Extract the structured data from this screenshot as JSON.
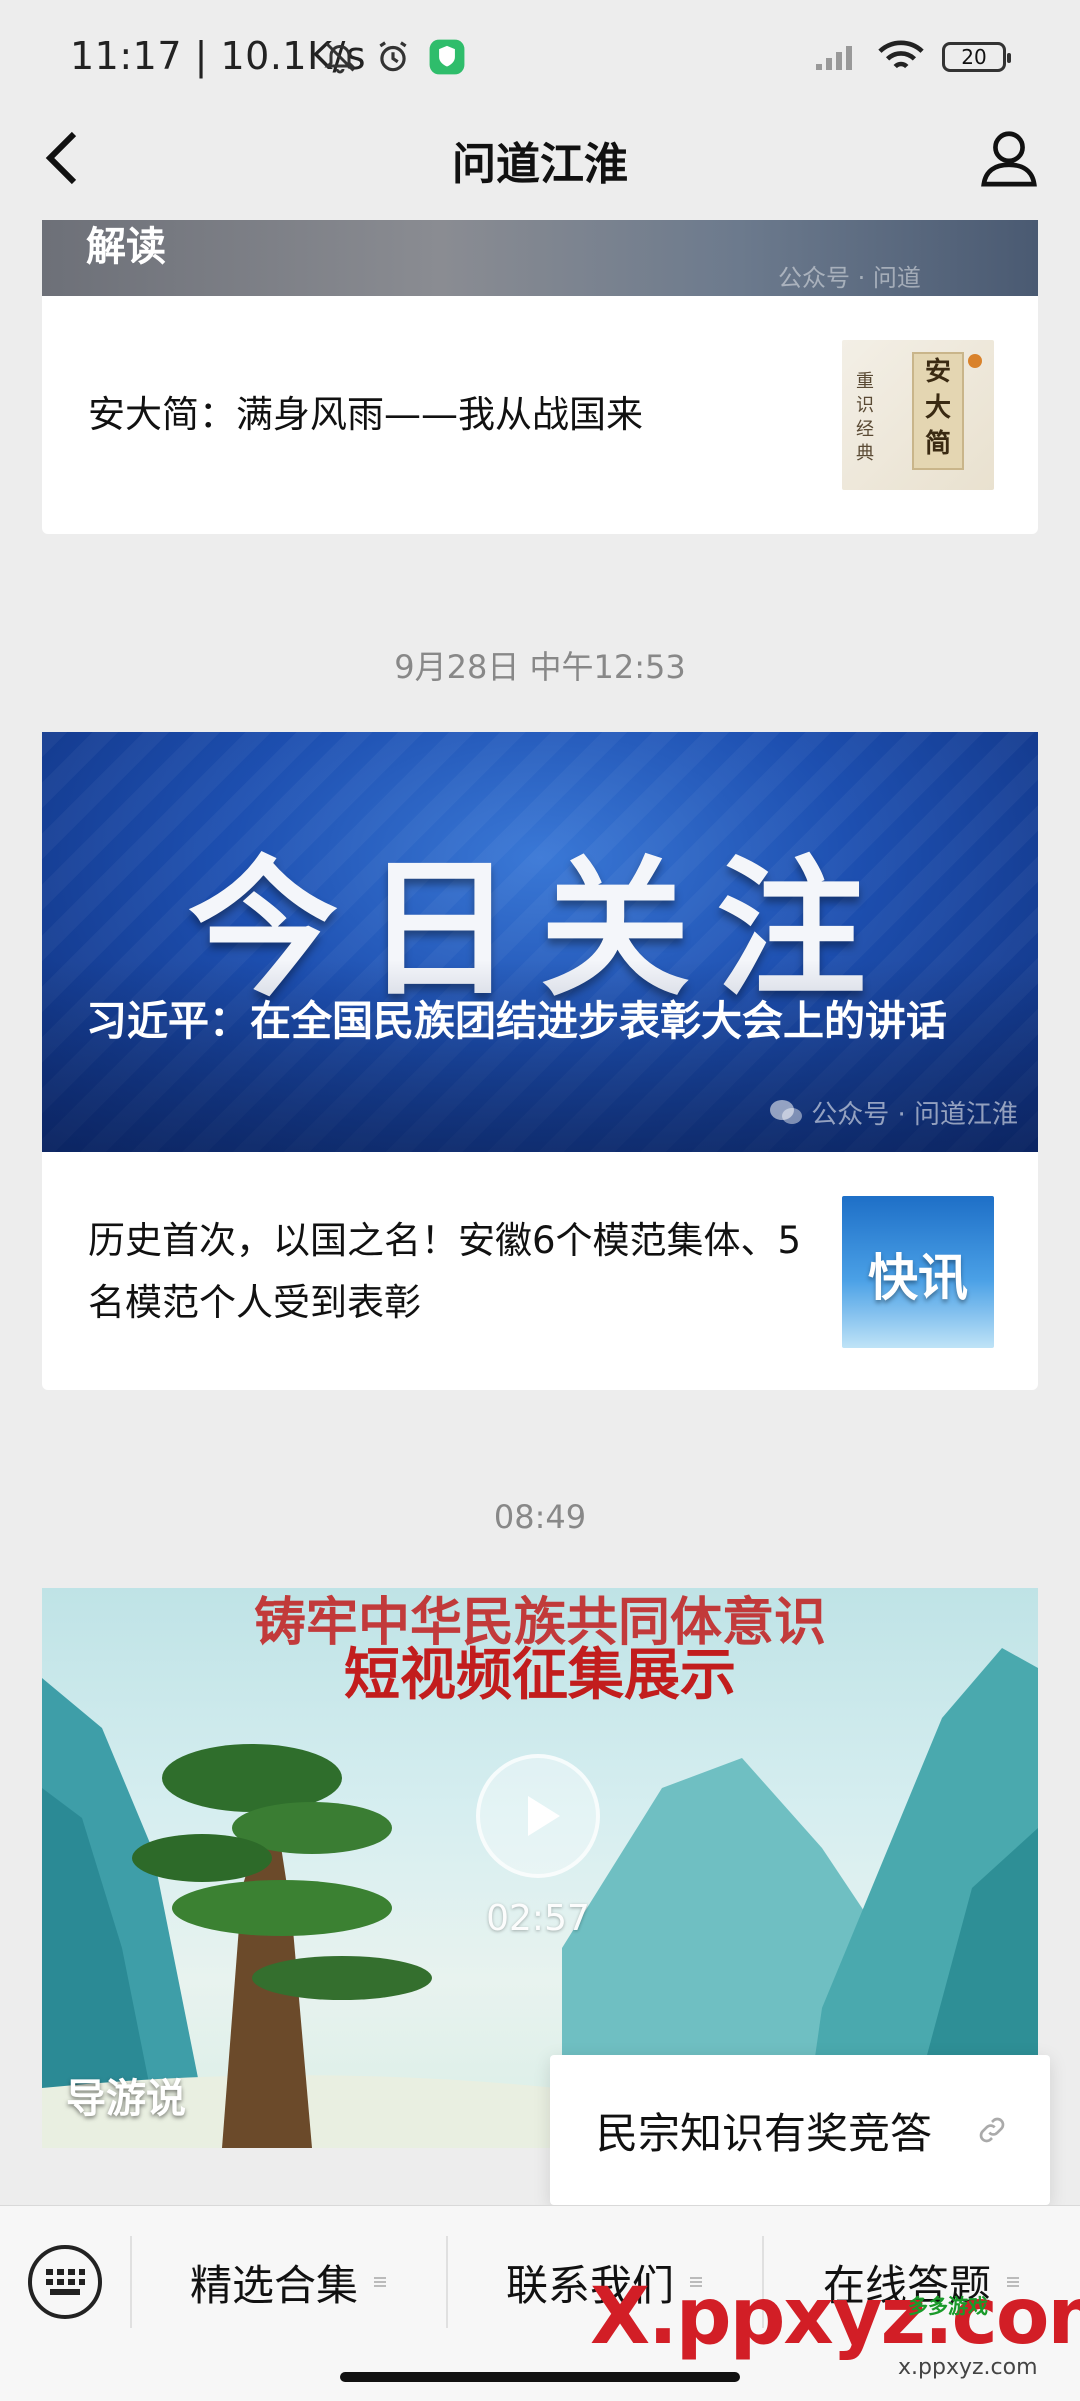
{
  "status": {
    "time": "11:17 | 10.1K/s",
    "battery": "20"
  },
  "nav": {
    "title": "问道江淮"
  },
  "feed": {
    "card1": {
      "banner_text": "解读",
      "banner_watermark": "公众号 · 问道",
      "item_title": "安大简：满身风雨——我从战国来",
      "thumb_text_right": "安大简",
      "thumb_text_left": "重识经典"
    },
    "time2": "9月28日 中午12:53",
    "card2": {
      "hero_big": "今日关注",
      "hero_title": "习近平：在全国民族团结进步表彰大会上的讲话",
      "hero_watermark": "公众号 · 问道江淮",
      "item_title": "历史首次，以国之名！安徽6个模范集体、5名模范个人受到表彰",
      "thumb_text": "快讯"
    },
    "time3": "08:49",
    "card3": {
      "hero_line1": "铸牢中华民族共同体意识",
      "hero_line2": "短视频征集展示",
      "duration": "02:57",
      "label": "导游说"
    }
  },
  "popup": {
    "label": "民宗知识有奖竞答"
  },
  "bottom_menu": {
    "items": [
      {
        "label": "精选合集"
      },
      {
        "label": "联系我们"
      },
      {
        "label": "在线答题"
      }
    ]
  },
  "watermark": {
    "big": "X.ppxyz.com",
    "small": "x.ppxyz.com",
    "tag": "多多游戏"
  },
  "colors": {
    "background": "#ededed",
    "hero_blue": "#1d4fb0",
    "video_red": "#c21d1d",
    "watermark_red": "#d21e26"
  },
  "icons": [
    "back-icon",
    "user-icon",
    "bell-off-icon",
    "alarm-icon",
    "shield-app-icon",
    "signal-icon",
    "wifi-icon",
    "battery-icon",
    "play-icon",
    "wechat-icon",
    "link-icon",
    "keyboard-icon",
    "menu-lines-icon"
  ]
}
